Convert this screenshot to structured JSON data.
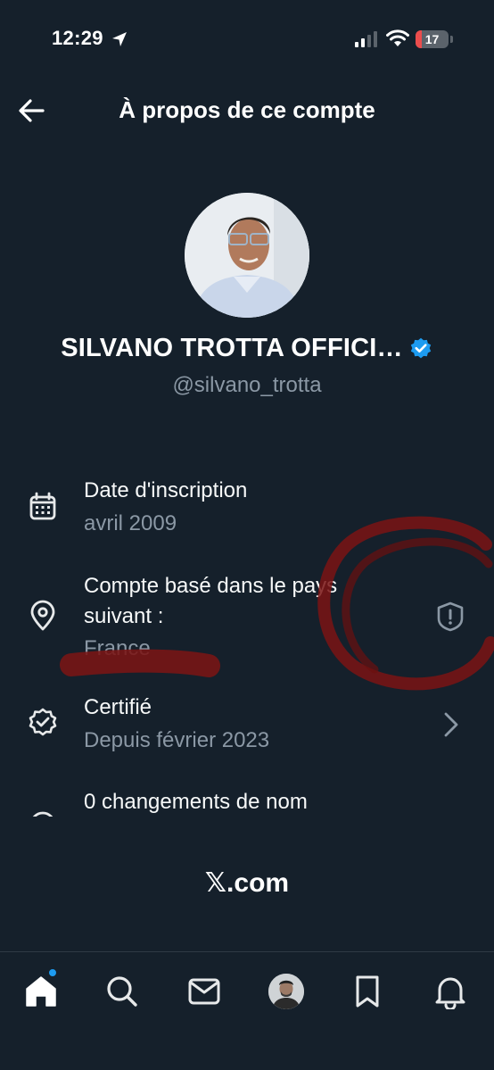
{
  "status_bar": {
    "time": "12:29",
    "battery_level": "17",
    "icons": [
      "location-arrow-icon",
      "cellular-signal-icon",
      "wifi-icon",
      "battery-icon"
    ]
  },
  "header": {
    "title": "À propos de ce compte",
    "back_icon": "arrow-left-icon"
  },
  "profile": {
    "display_name": "SILVANO TROTTA OFFICI…",
    "handle": "@silvano_trotta",
    "verified_color": "#1d9bf0"
  },
  "info": [
    {
      "icon": "calendar-icon",
      "title": "Date d'inscription",
      "subtitle": "avril 2009"
    },
    {
      "icon": "location-pin-icon",
      "title": "Compte basé dans le pays suivant :",
      "subtitle": "France",
      "action_icon": "shield-alert-icon"
    },
    {
      "icon": "verified-badge-icon",
      "title": "Certifié",
      "subtitle": "Depuis février 2023",
      "action_icon": "chevron-right-icon"
    },
    {
      "icon": "name-change-icon",
      "title": "0 changements de nom"
    }
  ],
  "footer": {
    "logo": "𝕏.com"
  },
  "tab_bar": {
    "items": [
      {
        "name": "home",
        "icon": "home-icon",
        "has_badge": true
      },
      {
        "name": "search",
        "icon": "search-icon"
      },
      {
        "name": "messages",
        "icon": "mail-icon"
      },
      {
        "name": "grok",
        "icon": "avatar-icon"
      },
      {
        "name": "bookmarks",
        "icon": "bookmark-icon"
      },
      {
        "name": "notifications",
        "icon": "bell-icon"
      }
    ]
  },
  "colors": {
    "background": "#15202b",
    "text_primary": "#e7e9ea",
    "text_secondary": "#8b98a5",
    "accent": "#1d9bf0",
    "annotation_red": "#7a1414"
  }
}
